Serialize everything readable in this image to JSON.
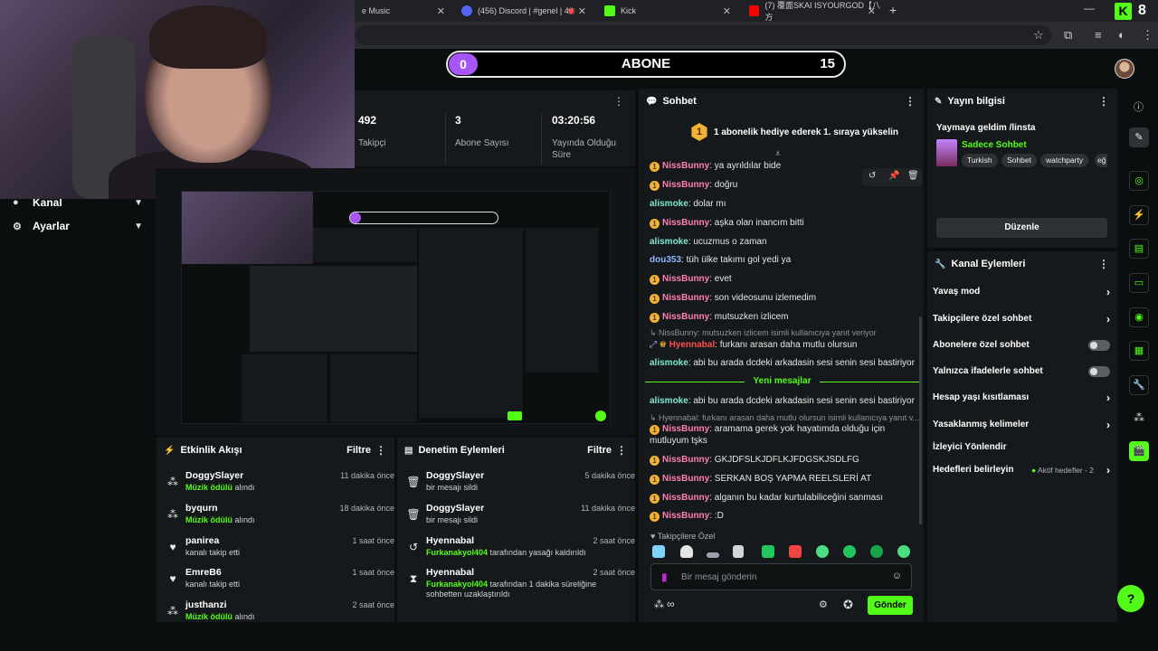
{
  "browser": {
    "tabs": [
      {
        "title": "e Music",
        "color": "#ff3d3d"
      },
      {
        "title": "(456) Discord | #genel | 40",
        "color": "#5865f2"
      },
      {
        "title": "Kick",
        "color": "#53fc18"
      },
      {
        "title": "(7) 覆面SKAI ISYOURGOD【八方",
        "color": "#ff0000"
      }
    ],
    "new_tab": "+",
    "kick_logo": "K",
    "tab_count": "8"
  },
  "goal": {
    "current": "0",
    "title": "ABONE",
    "target": "15"
  },
  "nav": [
    {
      "label": "Kanal",
      "icon": "user-icon"
    },
    {
      "label": "Ayarlar",
      "icon": "gear-icon"
    }
  ],
  "stats": [
    {
      "value": "492",
      "label": "Takipçi"
    },
    {
      "value": "3",
      "label": "Abone Sayısı"
    },
    {
      "value": "03:20:56",
      "label": "Yayında Olduğu Süre"
    }
  ],
  "activity": {
    "title": "Etkinlik Akışı",
    "filter": "Filtre",
    "items": [
      {
        "user": "DoggySlayer",
        "time": "11 dakika önce",
        "highlight": "Müzik ödülü",
        "text": " alındı",
        "icon": "gift"
      },
      {
        "user": "byqurn",
        "time": "18 dakika önce",
        "highlight": "Müzik ödülü",
        "text": " alındı",
        "icon": "gift"
      },
      {
        "user": "panirea",
        "time": "1 saat önce",
        "highlight": "",
        "text": "kanalı takip etti",
        "icon": "heart"
      },
      {
        "user": "EmreB6",
        "time": "1 saat önce",
        "highlight": "",
        "text": "kanalı takip etti",
        "icon": "heart"
      },
      {
        "user": "justhanzi",
        "time": "2 saat önce",
        "highlight": "Müzik ödülü",
        "text": " alındı",
        "icon": "gift"
      }
    ]
  },
  "moderation": {
    "title": "Denetim Eylemleri",
    "filter": "Filtre",
    "items": [
      {
        "user": "DoggySlayer",
        "time": "5 dakika önce",
        "highlight": "",
        "text": "bir mesajı sildi",
        "icon": "trash"
      },
      {
        "user": "DoggySlayer",
        "time": "11 dakika önce",
        "highlight": "",
        "text": "bir mesajı sildi",
        "icon": "trash"
      },
      {
        "user": "Hyennabal",
        "time": "2 saat önce",
        "highlight": "Furkanakyol404",
        "text": " tarafından yasağı kaldırıldı",
        "icon": "unban"
      },
      {
        "user": "Hyennabal",
        "time": "2 saat önce",
        "highlight": "Furkanakyol404",
        "text": " tarafından 1 dakika süreliğine sohbetten uzaklaştırıldı",
        "icon": "hourglass"
      }
    ]
  },
  "chat": {
    "title": "Sohbet",
    "pinned": "1 abonelik hediye ederek 1. sıraya yükselin",
    "pinned_badge": "1",
    "messages": [
      {
        "user": "NissBunny",
        "color": "#ff7fb5",
        "text": "ya ayrıldılar bide",
        "badge": true
      },
      {
        "user": "NissBunny",
        "color": "#ff7fb5",
        "text": "doğru",
        "badge": true
      },
      {
        "user": "alismoke",
        "color": "#7ee8d2",
        "text": "dolar mı",
        "badge": false
      },
      {
        "user": "NissBunny",
        "color": "#ff7fb5",
        "text": "aşka olan inancım bitti",
        "badge": true
      },
      {
        "user": "alismoke",
        "color": "#7ee8d2",
        "text": "ucuzmus o zaman",
        "badge": false
      },
      {
        "user": "dou353",
        "color": "#8fb7ff",
        "text": "tüh ülke takımı gol yedi ya",
        "badge": false
      },
      {
        "user": "NissBunny",
        "color": "#ff7fb5",
        "text": "evet",
        "badge": true
      },
      {
        "user": "NissBunny",
        "color": "#ff7fb5",
        "text": "son videosunu izlemedim",
        "badge": true
      },
      {
        "user": "NissBunny",
        "color": "#ff7fb5",
        "text": "mutsuzken izlicem",
        "badge": true
      },
      {
        "user": "Hyennabal",
        "color": "#ff4d4d",
        "text": "furkanı arasan daha mutlu olursun",
        "badge": false
      },
      {
        "user": "alismoke",
        "color": "#7ee8d2",
        "text": "abi bu arada dcdeki arkadasin sesi senin sesi bastiriyor",
        "badge": false
      },
      {
        "user": "alismoke",
        "color": "#7ee8d2",
        "text": "abi bu arada dcdeki arkadasin sesi senin sesi bastiriyor",
        "badge": false
      },
      {
        "user": "NissBunny",
        "color": "#ff7fb5",
        "text": "aramama gerek yok hayatımda olduğu için mutluyum tşks",
        "badge": true
      },
      {
        "user": "NissBunny",
        "color": "#ff7fb5",
        "text": "GKJDFSLKJDFLKJFDGSKJSDLFG",
        "badge": true
      },
      {
        "user": "NissBunny",
        "color": "#ff7fb5",
        "text": "SERKAN BOŞ YAPMA REELSLERİ AT",
        "badge": true
      },
      {
        "user": "NissBunny",
        "color": "#ff7fb5",
        "text": "alganın bu kadar kurtulabiliceğini sanması",
        "badge": true
      },
      {
        "user": "NissBunny",
        "color": "#ff7fb5",
        "text": ":D",
        "badge": true
      }
    ],
    "reply1": "NissBunny: mutsuzken izlicem isimli kullanıcıya yanıt veriyor",
    "reply2": "Hyennabal: furkanı arasan daha mutlu olursun isimli kullanıcıya yanıt v...",
    "new_messages": "Yeni mesajlar",
    "followers_only": "Takipçilere Özel",
    "input_placeholder": "Bir mesaj gönderin",
    "send": "Gönder"
  },
  "stream_info": {
    "title": "Yayın bilgisi",
    "stream_title": "Yaymaya geldim /linsta",
    "category": "Sadece Sohbet",
    "tags": [
      "Turkish",
      "Sohbet",
      "watchparty",
      "eğ"
    ],
    "edit": "Düzenle"
  },
  "channel_actions": {
    "title": "Kanal Eylemleri",
    "items": [
      {
        "label": "Yavaş mod",
        "control": "chevron"
      },
      {
        "label": "Takipçilere özel sohbet",
        "control": "chevron"
      },
      {
        "label": "Abonelere özel sohbet",
        "control": "toggle"
      },
      {
        "label": "Yalnızca ifadelerle sohbet",
        "control": "toggle"
      },
      {
        "label": "Hesap yaşı kısıtlaması",
        "control": "chevron"
      },
      {
        "label": "Yasaklanmış kelimeler",
        "control": "chevron"
      },
      {
        "label": "İzleyici Yönlendir",
        "control": "none"
      },
      {
        "label": "Hedefleri belirleyin",
        "control": "chevron"
      }
    ],
    "active_goals": "Aktif hedefler - 2"
  },
  "colors": {
    "accent": "#53fc18",
    "panel": "#16191b",
    "bg": "#0b0e0f",
    "badge": "#f2b233"
  }
}
